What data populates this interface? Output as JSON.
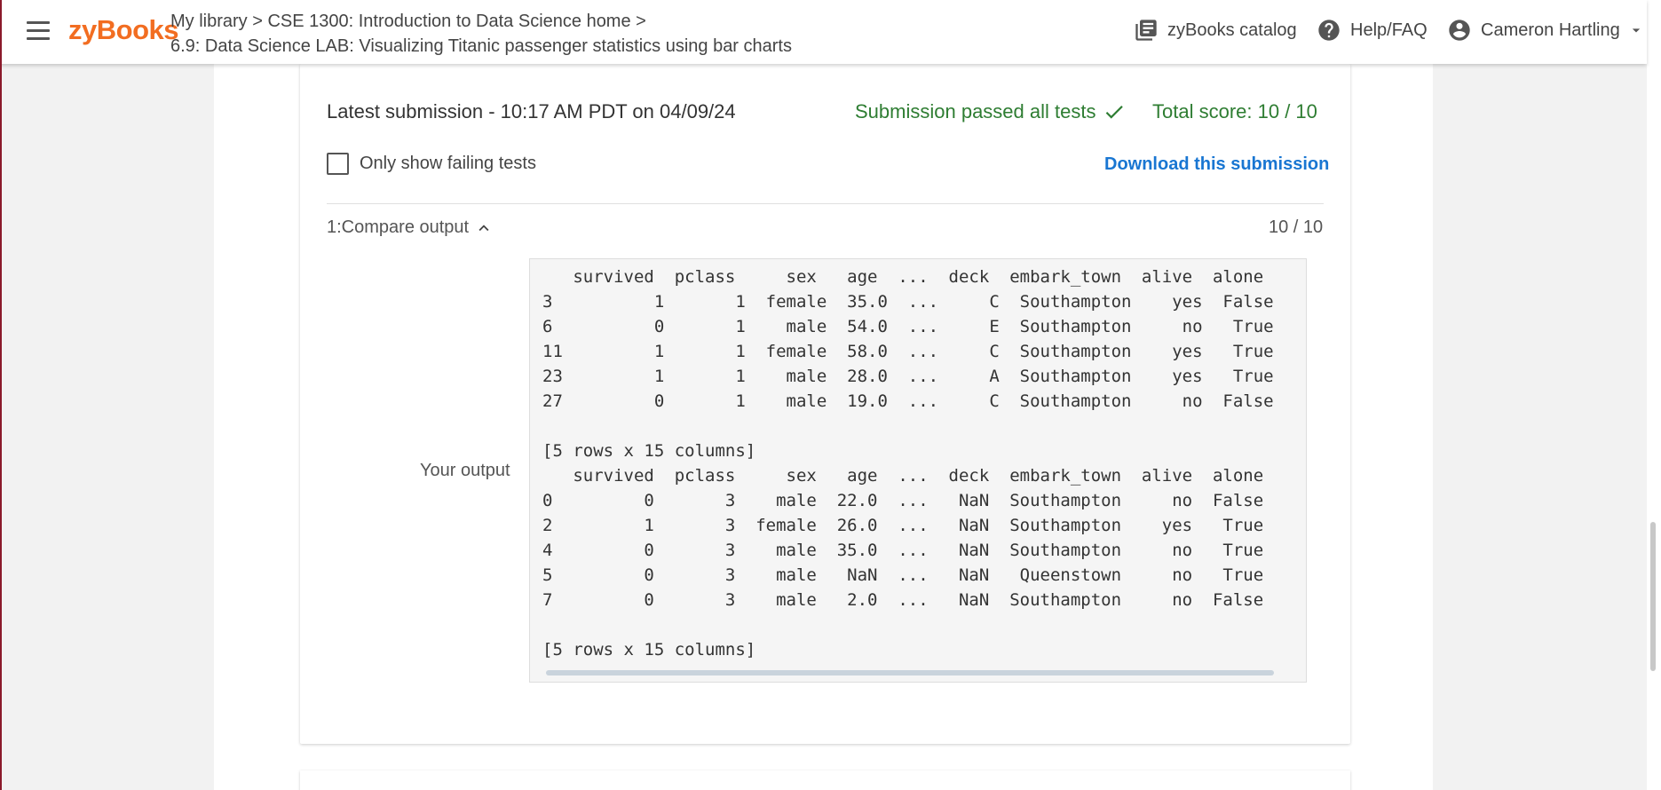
{
  "header": {
    "logo": "zyBooks",
    "breadcrumb_line1": "My library > CSE 1300: Introduction to Data Science home >",
    "breadcrumb_line2": "6.9: Data Science LAB: Visualizing Titanic passenger statistics using bar charts",
    "catalog_label": "zyBooks catalog",
    "help_label": "Help/FAQ",
    "user_name": "Cameron Hartling",
    "icons": [
      "menu-icon",
      "library-icon",
      "help-icon",
      "account-icon",
      "caret-down-icon"
    ]
  },
  "submission": {
    "latest": "Latest submission - 10:17 AM PDT on 04/09/24",
    "status": "Submission passed all tests",
    "total_score": "Total score: 10 / 10",
    "filter_label": "Only show failing tests",
    "filter_checked": false,
    "download_label": "Download this submission"
  },
  "test": {
    "title": "1:Compare output",
    "score": "10 / 10",
    "output_label": "Your output",
    "output_text": "   survived  pclass     sex   age  ...  deck  embark_town  alive  alone\n3          1       1  female  35.0  ...     C  Southampton    yes  False\n6          0       1    male  54.0  ...     E  Southampton     no   True\n11         1       1  female  58.0  ...     C  Southampton    yes   True\n23         1       1    male  28.0  ...     A  Southampton    yes   True\n27         0       1    male  19.0  ...     C  Southampton     no  False\n\n[5 rows x 15 columns]\n   survived  pclass     sex   age  ...  deck  embark_town  alive  alone\n0         0       3    male  22.0  ...   NaN  Southampton     no  False\n2         1       3  female  26.0  ...   NaN  Southampton    yes   True\n4         0       3    male  35.0  ...   NaN  Southampton     no   True\n5         0       3    male   NaN  ...   NaN   Queenstown     no   True\n7         0       3    male   2.0  ...   NaN  Southampton     no  False\n\n[5 rows x 15 columns]"
  },
  "colors": {
    "brand": "#f26d21",
    "pass": "#2e7d32",
    "link": "#1976d2"
  }
}
